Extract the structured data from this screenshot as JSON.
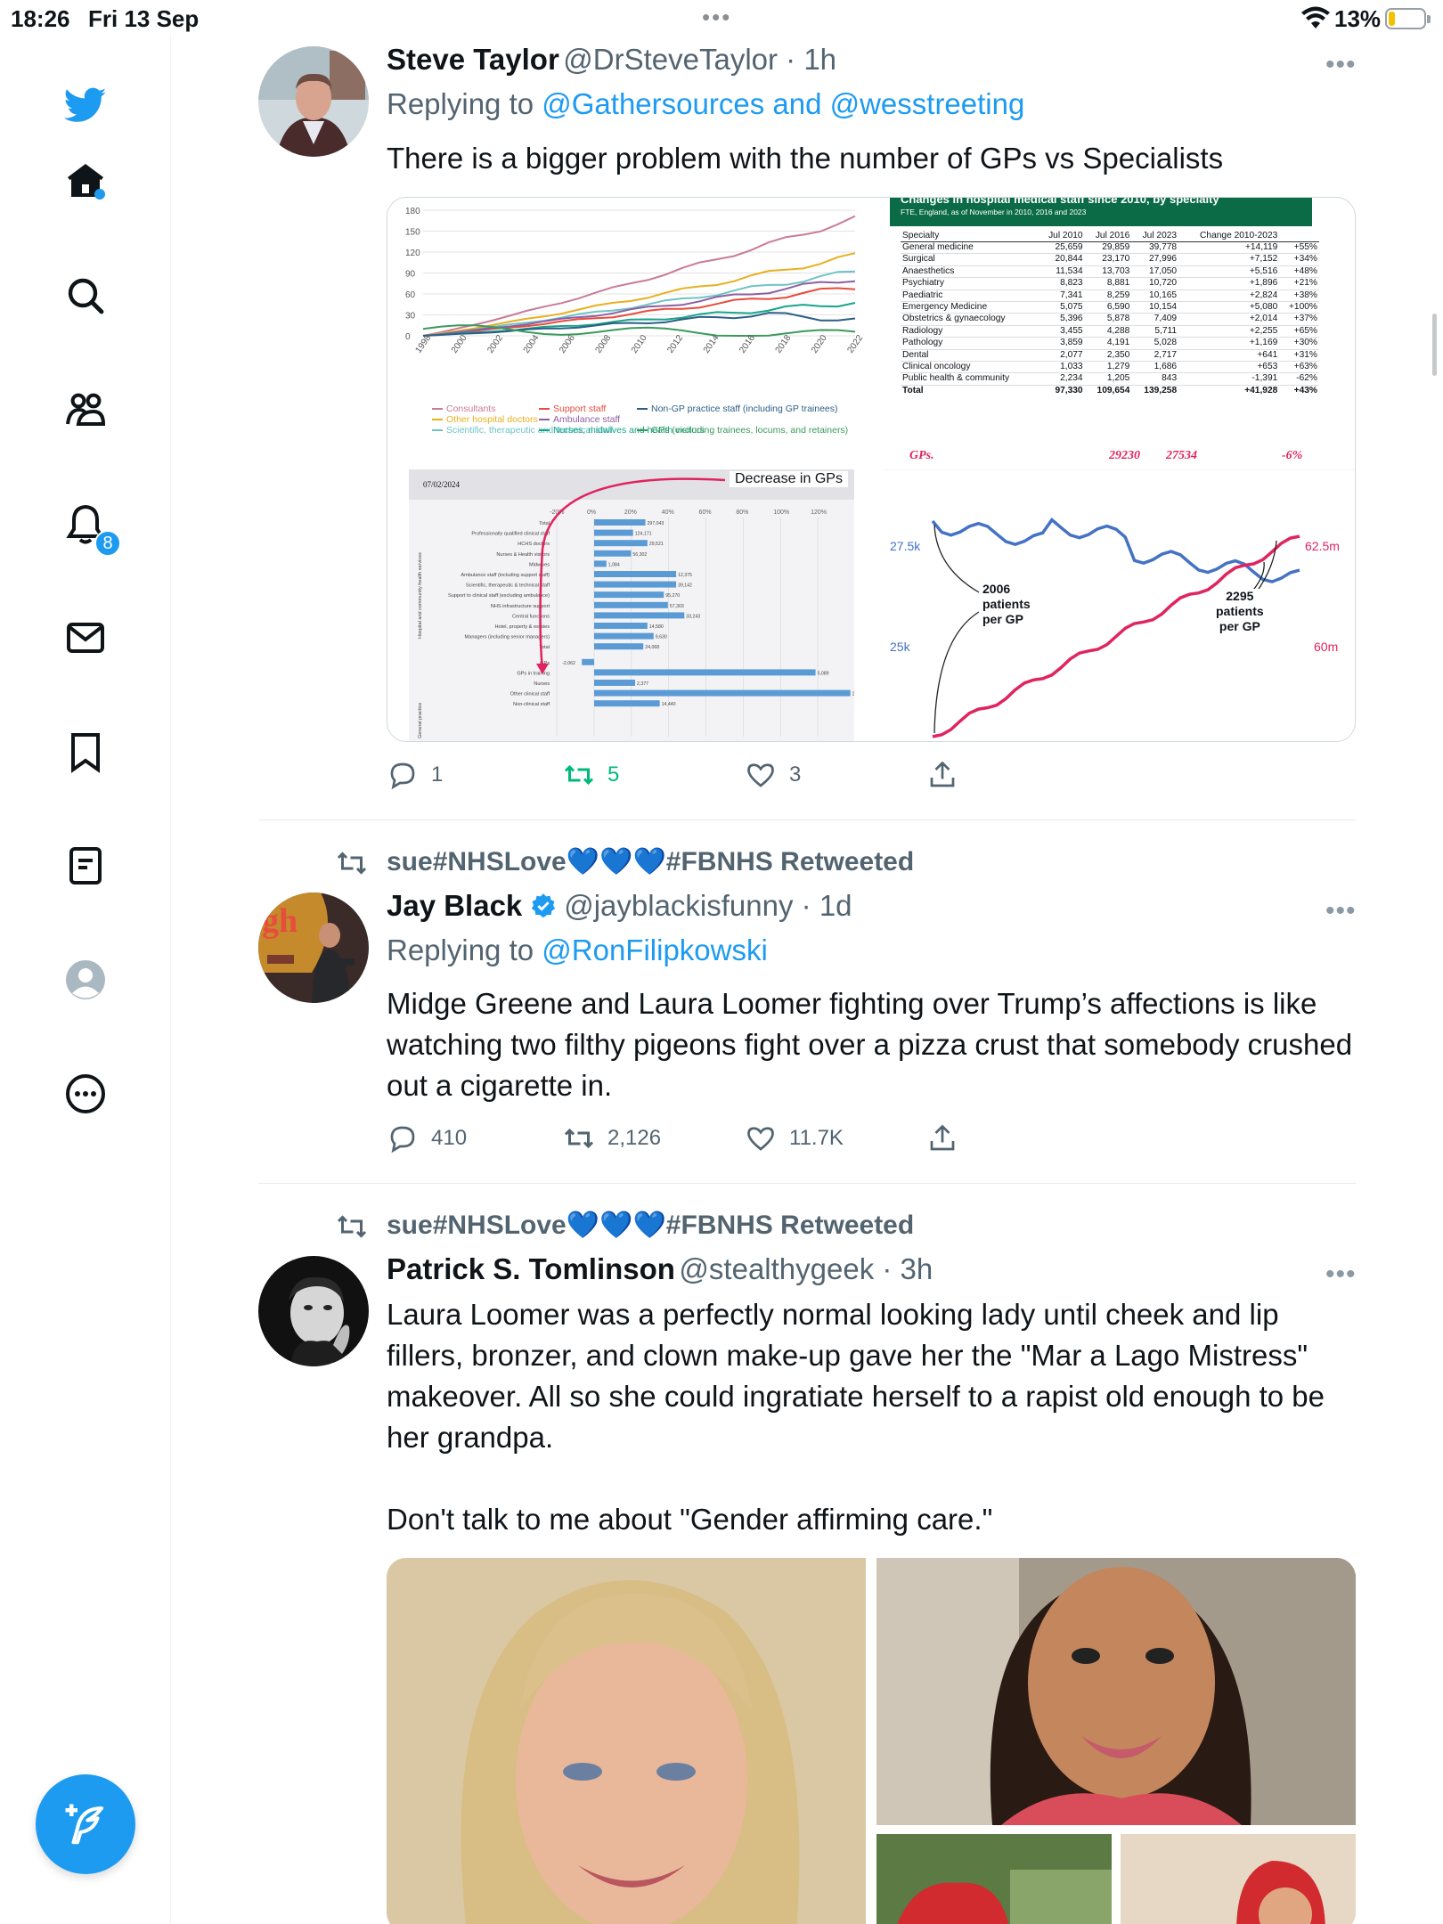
{
  "status_bar": {
    "time": "18:26",
    "date": "Fri 13 Sep",
    "dots": "•••",
    "battery": "13%"
  },
  "sidebar": {
    "notifications_count": "8"
  },
  "tweets": [
    {
      "name": "Steve Taylor",
      "handle": "@DrSteveTaylor",
      "time": "1h",
      "replying_prefix": "Replying to ",
      "replying_links": "@Gathersources and @wesstreeting",
      "text": "There is a bigger problem with the number of GPs vs Specialists",
      "replies": "1",
      "retweets": "5",
      "likes": "3",
      "media": {
        "line_chart": {
          "y_ticks": [
            "180",
            "150",
            "120",
            "90",
            "60",
            "30",
            "0"
          ],
          "x_ticks": [
            "1998",
            "2000",
            "2002",
            "2004",
            "2006",
            "2008",
            "2010",
            "2012",
            "2014",
            "2016",
            "2018",
            "2020",
            "2022"
          ],
          "legend": [
            "Consultants",
            "Other hospital doctors",
            "Scientific, therapeutic and technical staff",
            "Support staff",
            "Ambulance staff",
            "Nurses, midwives and health visitors",
            "Non-GP practice staff (including GP trainees)",
            "GPs (excluding trainees, locums, and retainers)"
          ]
        },
        "table": {
          "title": "Changes in hospital medical staff since 2010, by specialty",
          "subtitle": "FTE, England, as of November in 2010, 2016 and 2023",
          "columns": [
            "Specialty",
            "Jul 2010",
            "Jul 2016",
            "Jul 2023",
            "Change 2010-2023",
            ""
          ],
          "rows": [
            [
              "General medicine",
              "25,659",
              "29,859",
              "39,778",
              "+14,119",
              "+55%"
            ],
            [
              "Surgical",
              "20,844",
              "23,170",
              "27,996",
              "+7,152",
              "+34%"
            ],
            [
              "Anaesthetics",
              "11,534",
              "13,703",
              "17,050",
              "+5,516",
              "+48%"
            ],
            [
              "Psychiatry",
              "8,823",
              "8,881",
              "10,720",
              "+1,896",
              "+21%"
            ],
            [
              "Paediatric",
              "7,341",
              "8,259",
              "10,165",
              "+2,824",
              "+38%"
            ],
            [
              "Emergency Medicine",
              "5,075",
              "6,590",
              "10,154",
              "+5,080",
              "+100%"
            ],
            [
              "Obstetrics & gynaecology",
              "5,396",
              "5,878",
              "7,409",
              "+2,014",
              "+37%"
            ],
            [
              "Radiology",
              "3,455",
              "4,288",
              "5,711",
              "+2,255",
              "+65%"
            ],
            [
              "Pathology",
              "3,859",
              "4,191",
              "5,028",
              "+1,169",
              "+30%"
            ],
            [
              "Dental",
              "2,077",
              "2,350",
              "2,717",
              "+641",
              "+31%"
            ],
            [
              "Clinical oncology",
              "1,033",
              "1,279",
              "1,686",
              "+653",
              "+63%"
            ],
            [
              "Public health & community",
              "2,234",
              "1,205",
              "843",
              "-1,391",
              "-62%"
            ],
            [
              "Total",
              "97,330",
              "109,654",
              "139,258",
              "+41,928",
              "+43%"
            ]
          ],
          "gps_row": [
            "GPs.",
            "29230",
            "27534",
            "-6%"
          ]
        },
        "bar_chart": {
          "date": "07/02/2024",
          "annotation": "Decrease in GPs",
          "x_ticks": [
            "-20%",
            "0%",
            "20%",
            "40%",
            "60%",
            "80%",
            "100%",
            "120%"
          ],
          "rows": [
            {
              "label": "Total",
              "value": "297,043",
              "pct": 25
            },
            {
              "label": "Professionally qualified clinical staff",
              "value": "124,171",
              "pct": 19
            },
            {
              "label": "HCHS doctors",
              "value": "29,521",
              "pct": 26
            },
            {
              "label": "Nurses & Health visitors",
              "value": "56,302",
              "pct": 18
            },
            {
              "label": "Midwives",
              "value": "1,084",
              "pct": 6
            },
            {
              "label": "Ambulance staff (including support staff)",
              "value": "12,375",
              "pct": 40
            },
            {
              "label": "Scientific, therapeutic & technical staff",
              "value": "39,142",
              "pct": 40
            },
            {
              "label": "Support to clinical staff (excluding ambulance)",
              "value": "95,270",
              "pct": 34
            },
            {
              "label": "NHS infrastructure support",
              "value": "57,303",
              "pct": 36
            },
            {
              "label": "Central functions",
              "value": "33,243",
              "pct": 44
            },
            {
              "label": "Hotel, property & estates",
              "value": "14,580",
              "pct": 26
            },
            {
              "label": "Managers (including senior managers)",
              "value": "9,630",
              "pct": 29
            },
            {
              "label": "Total",
              "value": "24,068",
              "pct": 24
            },
            {
              "label": "GPs",
              "value": "-2,062",
              "pct": -6
            },
            {
              "label": "GPs in training",
              "value": "5,089",
              "pct": 108
            },
            {
              "label": "Nurses",
              "value": "2,377",
              "pct": 20
            },
            {
              "label": "Other clinical staff",
              "value": "29,507",
              "pct": 125
            },
            {
              "label": "Non-clinical staff",
              "value": "14,440",
              "pct": 32
            }
          ],
          "side_labels": [
            "Hospital and community health services",
            "General practice"
          ]
        },
        "dual_chart": {
          "left_top": "27.5k",
          "left_bottom": "25k",
          "right_top": "62.5m",
          "right_bottom": "60m",
          "annot_left": "2006\npatients\nper GP",
          "annot_right": "2295\npatients\nper GP"
        }
      }
    },
    {
      "retweeted_by": "sue#NHSLove💙💙💙#FBNHS Retweeted",
      "name": "Jay Black",
      "handle": "@jayblackisfunny",
      "time": "1d",
      "replying_prefix": "Replying to ",
      "replying_links": "@RonFilipkowski",
      "text": "Midge Greene and Laura Loomer fighting over Trump’s affections is like watching two filthy pigeons fight over a pizza crust that somebody crushed out a cigarette in.",
      "replies": "410",
      "retweets": "2,126",
      "likes": "11.7K"
    },
    {
      "retweeted_by": "sue#NHSLove💙💙💙#FBNHS Retweeted",
      "name": "Patrick S. Tomlinson",
      "handle": "@stealthygeek",
      "time": "3h",
      "text": "Laura Loomer was a perfectly normal looking lady until cheek and lip fillers, bronzer, and clown make-up gave her the \"Mar a Lago Mistress\" makeover. All so she could ingratiate herself to a rapist old enough to be her grandpa.\n\nDon't talk to me about \"Gender affirming care.\""
    }
  ],
  "colors": {
    "accent": "#1d9bf0",
    "retweet_green": "#00ba7c",
    "table_header": "#0b6b46",
    "series_red": "#e0245e",
    "series_blue": "#4472c4"
  }
}
